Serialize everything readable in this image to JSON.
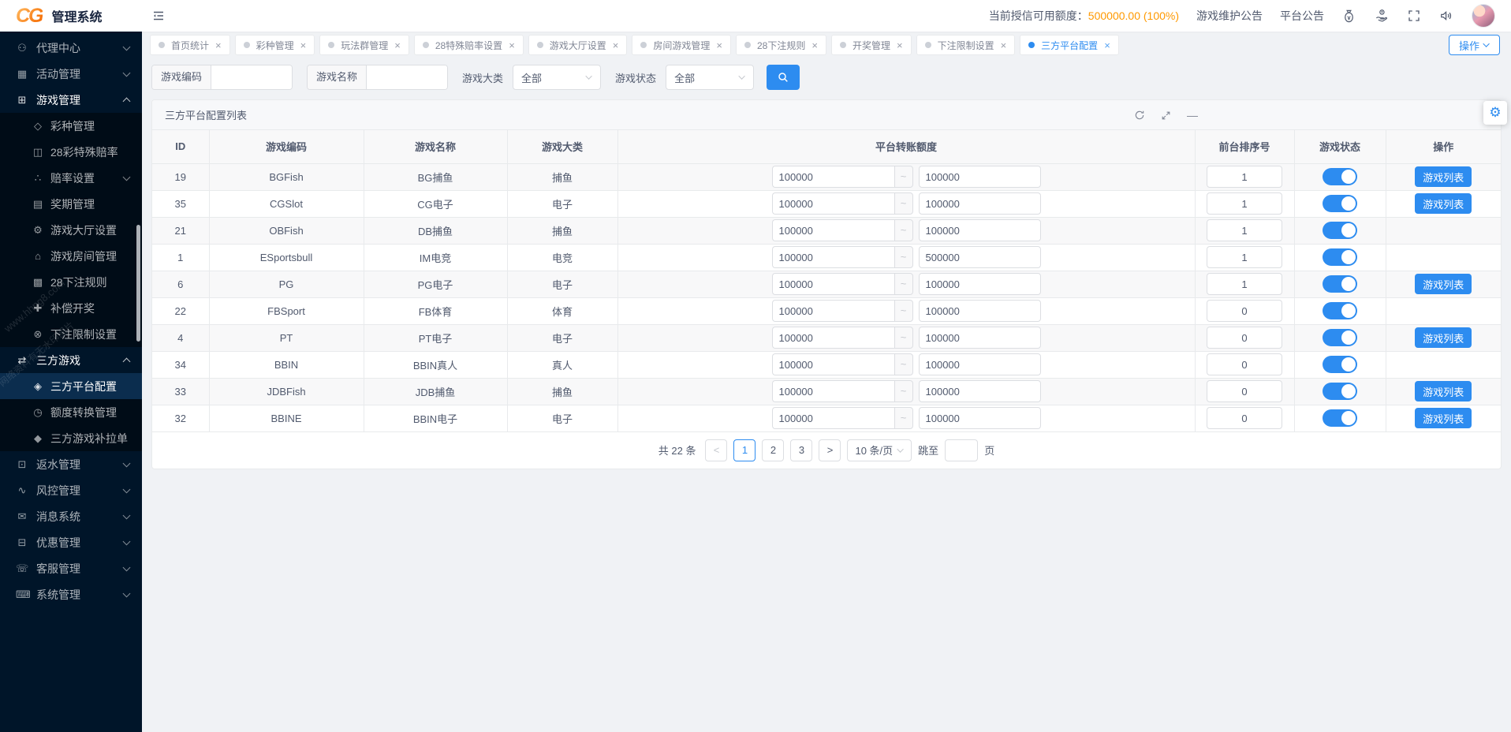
{
  "header": {
    "logo": "CG",
    "title": "管理系统",
    "credit_label": "当前授信可用额度：",
    "credit_value": "500000.00 (100%)",
    "links": [
      "游戏维护公告",
      "平台公告"
    ]
  },
  "sidebar": {
    "items": [
      {
        "label": "代理中心",
        "icon": "agent-center-icon",
        "glyph": "⚇",
        "level": 1,
        "chevron": "down"
      },
      {
        "label": "活动管理",
        "icon": "activity-management-icon",
        "glyph": "▦",
        "level": 1,
        "chevron": "down"
      },
      {
        "label": "游戏管理",
        "icon": "game-management-icon",
        "glyph": "⊞",
        "level": 1,
        "chevron": "up",
        "expanded": true
      },
      {
        "label": "彩种管理",
        "icon": "lottery-type-icon",
        "glyph": "◇",
        "level": 2
      },
      {
        "label": "28彩特殊赔率",
        "icon": "special-odds-icon",
        "glyph": "◫",
        "level": 2
      },
      {
        "label": "赔率设置",
        "icon": "odds-settings-icon",
        "glyph": "∴",
        "level": 2,
        "chevron": "down"
      },
      {
        "label": "奖期管理",
        "icon": "draw-period-icon",
        "glyph": "▤",
        "level": 2
      },
      {
        "label": "游戏大厅设置",
        "icon": "game-hall-settings-icon",
        "glyph": "⚙",
        "level": 2
      },
      {
        "label": "游戏房间管理",
        "icon": "game-room-icon",
        "glyph": "⌂",
        "level": 2
      },
      {
        "label": "28下注规则",
        "icon": "bet-rules-icon",
        "glyph": "▩",
        "level": 2
      },
      {
        "label": "补偿开奖",
        "icon": "makeup-draw-icon",
        "glyph": "✚",
        "level": 2
      },
      {
        "label": "下注限制设置",
        "icon": "bet-limit-icon",
        "glyph": "⊗",
        "level": 2
      },
      {
        "label": "三方游戏",
        "icon": "third-party-games-icon",
        "glyph": "⇄",
        "level": 1,
        "chevron": "up",
        "expanded": true
      },
      {
        "label": "三方平台配置",
        "icon": "platform-config-icon",
        "glyph": "◈",
        "level": 2,
        "active": true
      },
      {
        "label": "额度转换管理",
        "icon": "quota-convert-icon",
        "glyph": "◷",
        "level": 2
      },
      {
        "label": "三方游戏补拉单",
        "icon": "pull-order-icon",
        "glyph": "◆",
        "level": 2
      },
      {
        "label": "返水管理",
        "icon": "rebate-management-icon",
        "glyph": "⊡",
        "level": 1,
        "chevron": "down"
      },
      {
        "label": "风控管理",
        "icon": "risk-control-icon",
        "glyph": "∿",
        "level": 1,
        "chevron": "down"
      },
      {
        "label": "消息系统",
        "icon": "message-system-icon",
        "glyph": "✉",
        "level": 1,
        "chevron": "down"
      },
      {
        "label": "优惠管理",
        "icon": "promotion-management-icon",
        "glyph": "⊟",
        "level": 1,
        "chevron": "down"
      },
      {
        "label": "客服管理",
        "icon": "customer-service-icon",
        "glyph": "☏",
        "level": 1,
        "chevron": "down"
      },
      {
        "label": "系统管理",
        "icon": "system-management-icon",
        "glyph": "⌨",
        "level": 1,
        "chevron": "down"
      }
    ],
    "watermarks": [
      "www.hhpg8.com",
      "网络资料有无水印图片"
    ]
  },
  "tabs": {
    "items": [
      {
        "label": "首页统计"
      },
      {
        "label": "彩种管理"
      },
      {
        "label": "玩法群管理"
      },
      {
        "label": "28特殊赔率设置"
      },
      {
        "label": "游戏大厅设置"
      },
      {
        "label": "房间游戏管理"
      },
      {
        "label": "28下注规则"
      },
      {
        "label": "开奖管理"
      },
      {
        "label": "下注限制设置"
      },
      {
        "label": "三方平台配置",
        "active": true
      }
    ],
    "close_glyph": "×",
    "action_label": "操作"
  },
  "filters": {
    "code_label": "游戏编码",
    "name_label": "游戏名称",
    "category_label": "游戏大类",
    "category_value": "全部",
    "status_label": "游戏状态",
    "status_value": "全部"
  },
  "panel": {
    "title": "三方平台配置列表"
  },
  "table": {
    "columns": [
      "ID",
      "游戏编码",
      "游戏名称",
      "游戏大类",
      "平台转账额度",
      "前台排序号",
      "游戏状态",
      "操作"
    ],
    "range_separator": "~",
    "rows": [
      {
        "id": "19",
        "code": "BGFish",
        "name": "BG捕鱼",
        "category": "捕鱼",
        "quota_min": "100000",
        "quota_max": "100000",
        "sort": "1",
        "status": true,
        "action": "游戏列表"
      },
      {
        "id": "35",
        "code": "CGSlot",
        "name": "CG电子",
        "category": "电子",
        "quota_min": "100000",
        "quota_max": "100000",
        "sort": "1",
        "status": true,
        "action": "游戏列表"
      },
      {
        "id": "21",
        "code": "OBFish",
        "name": "DB捕鱼",
        "category": "捕鱼",
        "quota_min": "100000",
        "quota_max": "100000",
        "sort": "1",
        "status": true,
        "action": ""
      },
      {
        "id": "1",
        "code": "ESportsbull",
        "name": "IM电竞",
        "category": "电竞",
        "quota_min": "100000",
        "quota_max": "500000",
        "sort": "1",
        "status": true,
        "action": ""
      },
      {
        "id": "6",
        "code": "PG",
        "name": "PG电子",
        "category": "电子",
        "quota_min": "100000",
        "quota_max": "100000",
        "sort": "1",
        "status": true,
        "action": "游戏列表"
      },
      {
        "id": "22",
        "code": "FBSport",
        "name": "FB体育",
        "category": "体育",
        "quota_min": "100000",
        "quota_max": "100000",
        "sort": "0",
        "status": true,
        "action": ""
      },
      {
        "id": "4",
        "code": "PT",
        "name": "PT电子",
        "category": "电子",
        "quota_min": "100000",
        "quota_max": "100000",
        "sort": "0",
        "status": true,
        "action": "游戏列表"
      },
      {
        "id": "34",
        "code": "BBIN",
        "name": "BBIN真人",
        "category": "真人",
        "quota_min": "100000",
        "quota_max": "100000",
        "sort": "0",
        "status": true,
        "action": ""
      },
      {
        "id": "33",
        "code": "JDBFish",
        "name": "JDB捕鱼",
        "category": "捕鱼",
        "quota_min": "100000",
        "quota_max": "100000",
        "sort": "0",
        "status": true,
        "action": "游戏列表"
      },
      {
        "id": "32",
        "code": "BBINE",
        "name": "BBIN电子",
        "category": "电子",
        "quota_min": "100000",
        "quota_max": "100000",
        "sort": "0",
        "status": true,
        "action": "游戏列表"
      }
    ]
  },
  "pagination": {
    "total": "共 22 条",
    "prev_label": "<",
    "next_label": ">",
    "pages": [
      "1",
      "2",
      "3"
    ],
    "active_page": "1",
    "page_size": "10 条/页",
    "jump_label": "跳至",
    "page_unit": "页"
  },
  "icons": {
    "gear_glyph": "⚙",
    "minus_glyph": "—"
  },
  "colors": {
    "accent": "#2d8cf0",
    "sidebar_bg": "#001529",
    "submenu_bg": "#000c17",
    "active_item_bg": "#0b2d4e",
    "credit_orange": "#ff9900",
    "stripe": "#f8f8f9",
    "border": "#e8eaec"
  }
}
